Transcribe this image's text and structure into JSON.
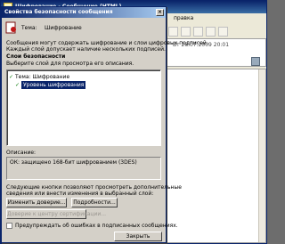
{
  "background": {
    "window_title": "Шифрование - Сообщение (HTML)",
    "menu_item": "правка",
    "sent_text": "Вт 28.07.2009 20:01"
  },
  "dialog": {
    "title": "Свойства безопасности сообщения",
    "close": "×",
    "subject_label": "Тема:",
    "subject_value": "Шифрование",
    "info_line1": "Сообщения могут содержать шифрование и слои цифровых подписей.",
    "info_line2": "Каждый слой допускает наличие нескольких подписей.",
    "layers_heading": "Слои безопасности",
    "layers_instruction": "Выберите слой для просмотра его описания.",
    "layers": [
      {
        "label": "Тема: Шифрование"
      },
      {
        "label": "Уровень шифрования"
      }
    ],
    "description_label": "Описание:",
    "description_value": "ОК: защищено 168-бит шифрованием (3DES)",
    "buttons_hint_line1": "Следующие кнопки позволяют просмотреть дополнительные",
    "buttons_hint_line2": "сведения или внести изменения в выбранный слой:",
    "edit_trust_button": "Изменить доверие...",
    "details_button": "Подробности...",
    "trust_ca_button": "Доверие к центру сертификации...",
    "warn_checkbox_label": "Предупреждать об ошибках в подписанных сообщениях.",
    "close_button": "Закрыть"
  }
}
